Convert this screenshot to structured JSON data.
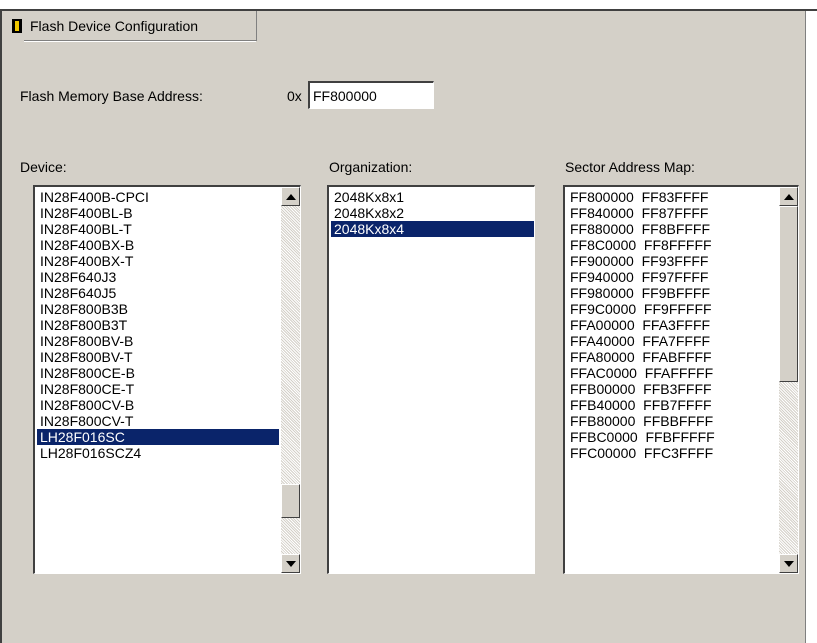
{
  "titlebar": {
    "title": "Flash Device Configuration"
  },
  "base_address": {
    "label": "Flash Memory Base Address:",
    "prefix": "0x",
    "value": "FF800000"
  },
  "device": {
    "label": "Device:",
    "items": [
      "IN28F400B-CPCI",
      "IN28F400BL-B",
      "IN28F400BL-T",
      "IN28F400BX-B",
      "IN28F400BX-T",
      "IN28F640J3",
      "IN28F640J5",
      "IN28F800B3B",
      "IN28F800B3T",
      "IN28F800BV-B",
      "IN28F800BV-T",
      "IN28F800CE-B",
      "IN28F800CE-T",
      "IN28F800CV-B",
      "IN28F800CV-T",
      "LH28F016SC",
      "LH28F016SCZ4"
    ],
    "selected": "LH28F016SC"
  },
  "organization": {
    "label": "Organization:",
    "items": [
      "2048Kx8x1",
      "2048Kx8x2",
      "2048Kx8x4"
    ],
    "selected": "2048Kx8x4"
  },
  "sector_map": {
    "label": "Sector Address Map:",
    "items": [
      "FF800000  FF83FFFF",
      "FF840000  FF87FFFF",
      "FF880000  FF8BFFFF",
      "FF8C0000  FF8FFFFF",
      "FF900000  FF93FFFF",
      "FF940000  FF97FFFF",
      "FF980000  FF9BFFFF",
      "FF9C0000  FF9FFFFF",
      "FFA00000  FFA3FFFF",
      "FFA40000  FFA7FFFF",
      "FFA80000  FFABFFFF",
      "FFAC0000  FFAFFFFF",
      "FFB00000  FFB3FFFF",
      "FFB40000  FFB7FFFF",
      "FFB80000  FFBBFFFF",
      "FFBC0000  FFBFFFFF",
      "FFC00000  FFC3FFFF"
    ]
  },
  "icons": {
    "title": "flash-device-icon",
    "scroll_up": "arrow-up-icon",
    "scroll_down": "arrow-down-icon"
  },
  "colors": {
    "face": "#d4d0c8",
    "selection": "#0a246a",
    "title_icon": "#f0c800"
  }
}
